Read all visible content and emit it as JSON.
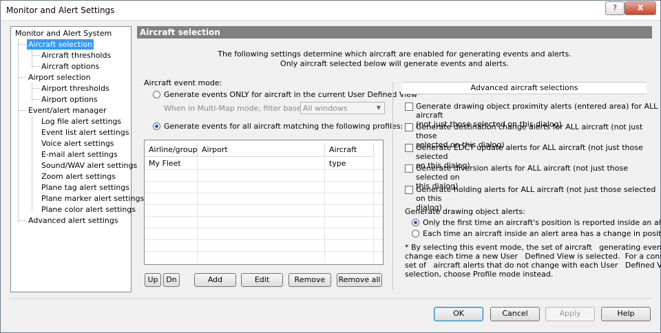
{
  "window": {
    "title": "Monitor and Alert Settings",
    "help_glyph": "?",
    "close_glyph": "X"
  },
  "tree": {
    "items": [
      {
        "label": "Monitor and Alert System"
      },
      {
        "label": "Aircraft selection"
      },
      {
        "label": "Aircraft thresholds"
      },
      {
        "label": "Aircraft options"
      },
      {
        "label": "Airport selection"
      },
      {
        "label": "Airport thresholds"
      },
      {
        "label": "Airport options"
      },
      {
        "label": "Event/alert manager"
      },
      {
        "label": "Log file alert settings"
      },
      {
        "label": "Event list alert settings"
      },
      {
        "label": "Voice alert settings"
      },
      {
        "label": "E-mail alert settings"
      },
      {
        "label": "Sound/WAV alert settings"
      },
      {
        "label": "Zoom alert settings"
      },
      {
        "label": "Plane tag alert settings"
      },
      {
        "label": "Plane marker alert settings"
      },
      {
        "label": "Plane color alert settings"
      },
      {
        "label": "Advanced alert settings"
      }
    ],
    "selected": "Aircraft selection"
  },
  "panel": {
    "header": "Aircraft selection",
    "desc_line1": "The following settings determine which aircraft are enabled for generating events and alerts.",
    "desc_line2": "Only aircraft selected below will generate events and alerts."
  },
  "event_mode": {
    "label": "Aircraft event mode:",
    "option_view": "Generate events ONLY for aircraft in the current User Defined View*",
    "multimap_label": "When in Multi-Map mode, filter based on:",
    "multimap_value": "All windows",
    "option_profiles": "Generate events for all aircraft matching the following profiles:",
    "selected": "profiles"
  },
  "profiles_table": {
    "columns": [
      "Airline/group",
      "Airport",
      "Aircraft type"
    ],
    "rows": [
      [
        "My Fleet",
        "",
        ""
      ]
    ]
  },
  "list_buttons": {
    "up": "Up",
    "dn": "Dn",
    "add": "Add",
    "edit": "Edit",
    "remove": "Remove",
    "remove_all": "Remove all"
  },
  "advanced": {
    "title": "Advanced aircraft selections",
    "checks": [
      {
        "line1": "Generate drawing object proximity alerts (entered area) for ALL aircraft",
        "line2": "(not just those selected on this dialog)",
        "checked": false
      },
      {
        "line1": "Generate destination change alerts for ALL aircraft (not just those",
        "line2": "selected on this dialog)",
        "checked": false
      },
      {
        "line1": "Generate EDCT update alerts for ALL aircraft (not just those selected",
        "line2": "on this dialog)",
        "checked": false
      },
      {
        "line1": "Generate diversion alerts for ALL aircraft (not just those selected on",
        "line2": "this dialog)",
        "checked": false
      },
      {
        "line1": "Generate holding alerts for ALL aircraft (not just those selected on this",
        "line2": "dialog)",
        "checked": false
      }
    ],
    "drawing_label": "Generate drawing object alerts:",
    "drawing_first": "Only the first time an aircraft's position is reported inside an alert area",
    "drawing_each": "Each time an aircraft inside an alert area has a change in position",
    "drawing_selected": "first",
    "note": [
      "* By selecting this event mode, the set of aircraft   generating events will",
      "change each time a new User   Defined View is selected.  For a consistent",
      "set of   aircraft alerts that do not change with each User   Defined View",
      "selection, choose Profile mode instead."
    ]
  },
  "footer": {
    "ok": "OK",
    "cancel": "Cancel",
    "apply": "Apply",
    "help": "Help"
  }
}
